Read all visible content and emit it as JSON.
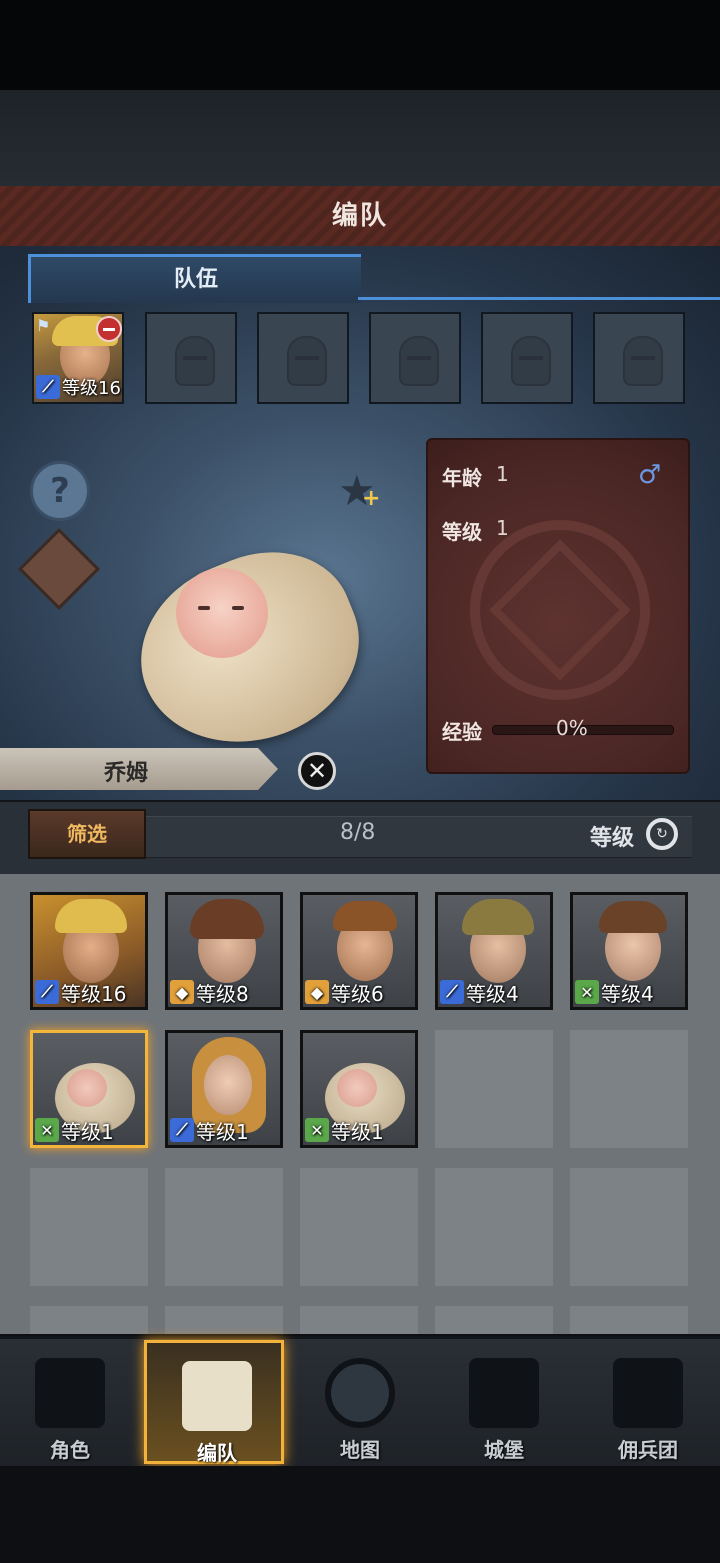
{
  "screen": {
    "title": "编队"
  },
  "team_tab": {
    "label": "队伍"
  },
  "team_slots": [
    {
      "filled": true,
      "level_text": "等级16",
      "class_icon": "sword-icon",
      "leader": true
    }
  ],
  "selected_character": {
    "name": "乔姆",
    "age_label": "年龄",
    "age": "1",
    "level_label": "等级",
    "level": "1",
    "exp_label": "经验",
    "exp_percent": "0%",
    "gender_symbol": "♂",
    "exp_fraction": 0
  },
  "filter_bar": {
    "filter_label": "筛选",
    "count": "8/8",
    "sort_label": "等级"
  },
  "roster": [
    {
      "level_text": "等级16",
      "class": "sword",
      "selected": false
    },
    {
      "level_text": "等级8",
      "class": "shield",
      "selected": false
    },
    {
      "level_text": "等级6",
      "class": "shield",
      "selected": false
    },
    {
      "level_text": "等级4",
      "class": "sword",
      "selected": false
    },
    {
      "level_text": "等级4",
      "class": "cross",
      "selected": false
    },
    {
      "level_text": "等级1",
      "class": "cross",
      "selected": true
    },
    {
      "level_text": "等级1",
      "class": "sword",
      "selected": false
    },
    {
      "level_text": "等级1",
      "class": "cross",
      "selected": false
    }
  ],
  "nav": [
    {
      "label": "角色",
      "icon": "knight-icon"
    },
    {
      "label": "编队",
      "icon": "formation-icon",
      "active": true
    },
    {
      "label": "地图",
      "icon": "compass-map-icon"
    },
    {
      "label": "城堡",
      "icon": "castle-icon"
    },
    {
      "label": "佣兵团",
      "icon": "banner-icon"
    }
  ],
  "colors": {
    "accent_blue": "#4b90d8",
    "gold_highlight": "#f2b23c",
    "card_red": "#4a2624"
  }
}
